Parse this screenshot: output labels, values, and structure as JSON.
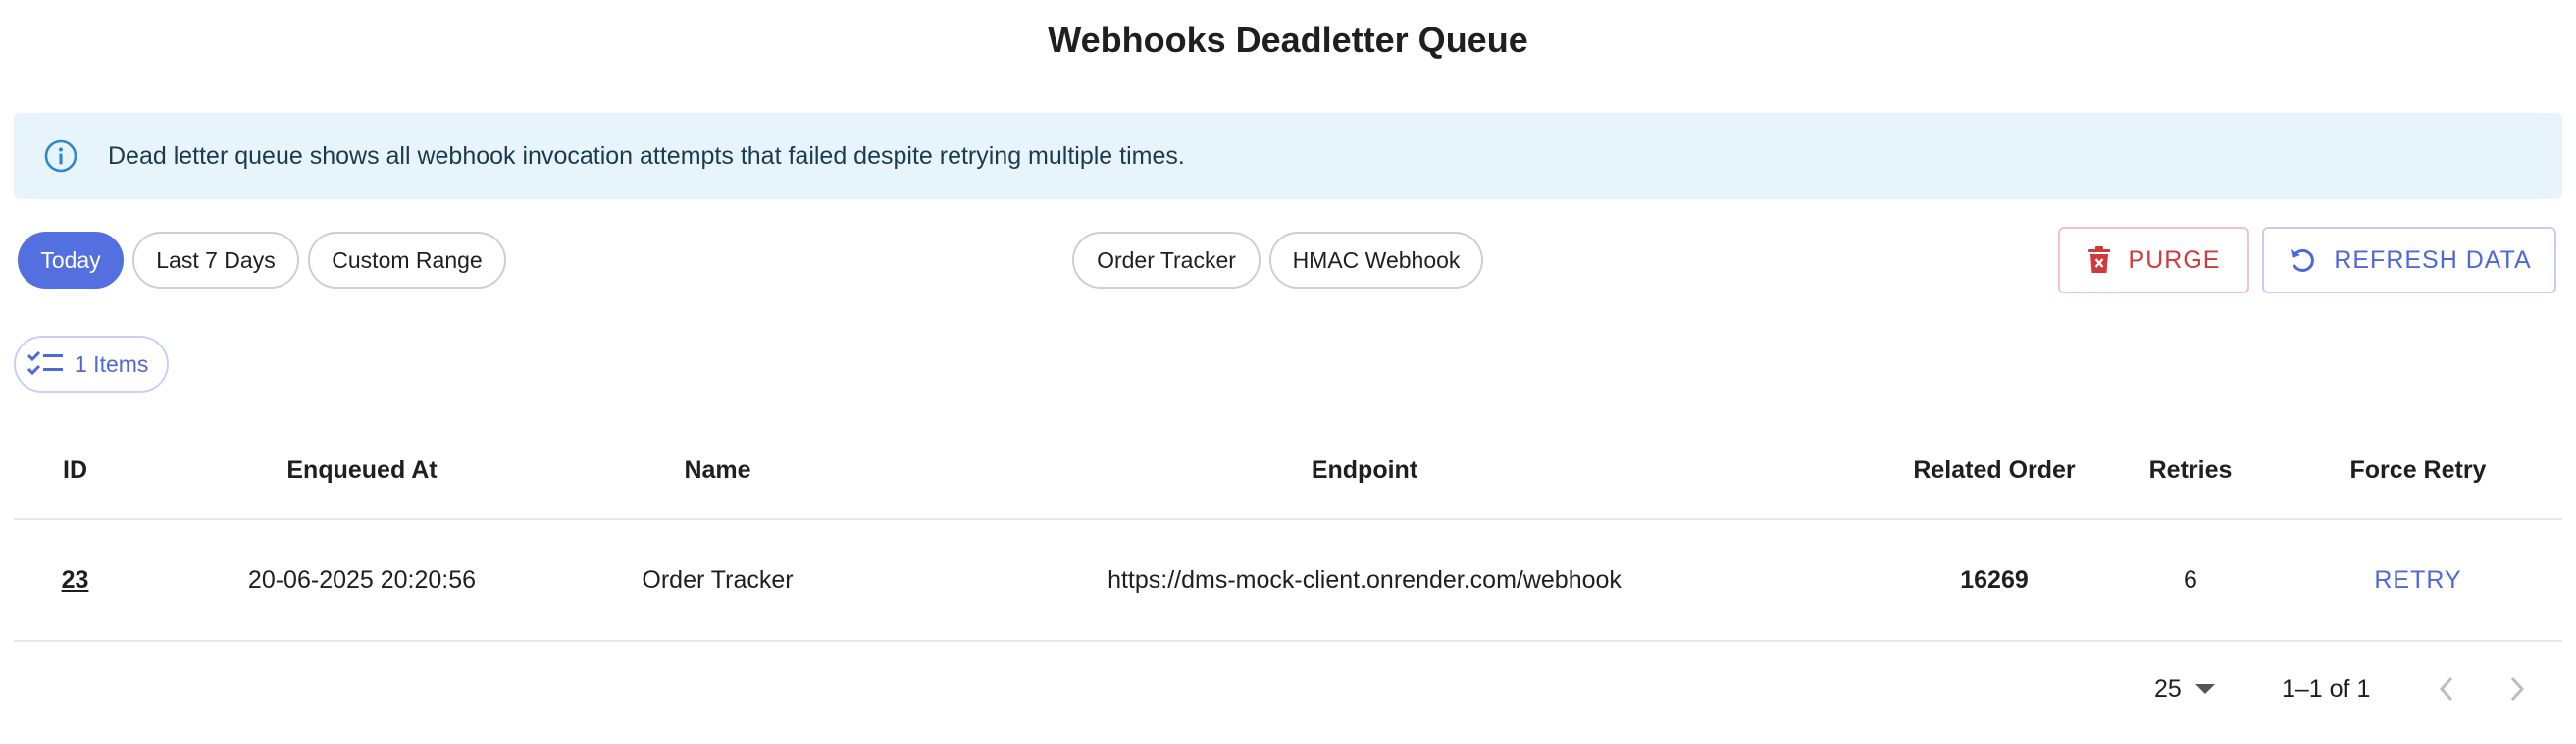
{
  "page": {
    "title": "Webhooks Deadletter Queue"
  },
  "alert": {
    "icon": "info-icon",
    "text": "Dead letter queue shows all webhook invocation attempts that failed despite retrying multiple times."
  },
  "date_filters": [
    {
      "label": "Today",
      "selected": true
    },
    {
      "label": "Last 7 Days",
      "selected": false
    },
    {
      "label": "Custom Range",
      "selected": false
    }
  ],
  "webhook_filters": [
    {
      "label": "Order Tracker"
    },
    {
      "label": "HMAC Webhook"
    }
  ],
  "actions": {
    "purge_label": "PURGE",
    "purge_icon": "trash-icon",
    "refresh_label": "REFRESH DATA",
    "refresh_icon": "refresh-icon"
  },
  "items_count": {
    "label": "1 Items",
    "icon": "checklist-icon"
  },
  "table": {
    "columns": [
      "ID",
      "Enqueued At",
      "Name",
      "Endpoint",
      "Related Order",
      "Retries",
      "Force Retry"
    ],
    "rows": [
      {
        "id": "23",
        "enqueued_at": "20-06-2025 20:20:56",
        "name": "Order Tracker",
        "endpoint": "https://dms-mock-client.onrender.com/webhook",
        "related_order": "16269",
        "retries": "6",
        "action_label": "RETRY"
      }
    ]
  },
  "pagination": {
    "rows_per_page": "25",
    "range": "1–1 of 1"
  },
  "colors": {
    "accent": "#5470e0",
    "danger": "#d13a3a",
    "alert_bg": "#e8f4fc"
  }
}
